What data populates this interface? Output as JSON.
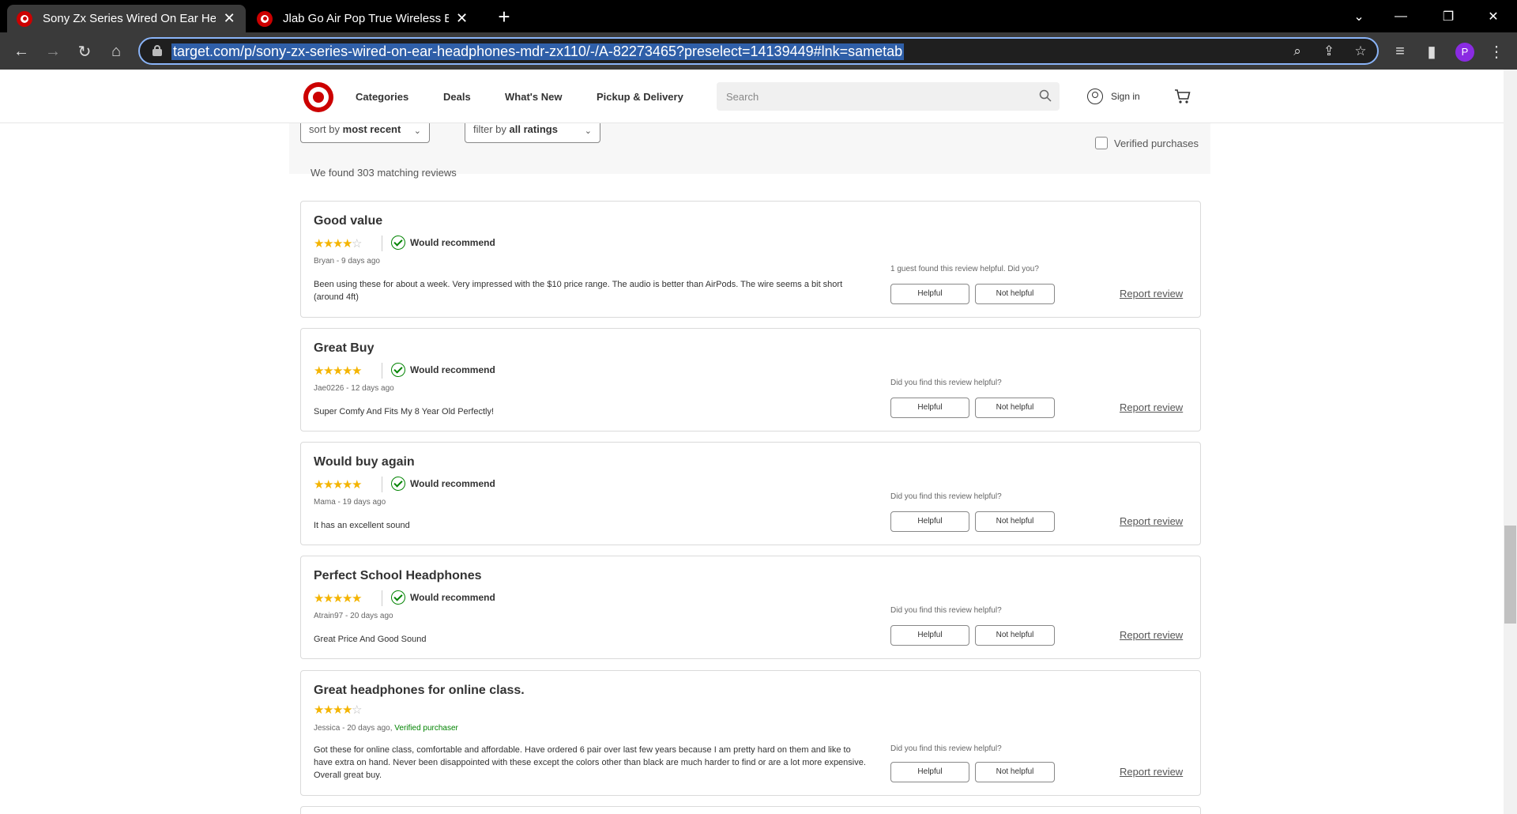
{
  "browser": {
    "tabs": [
      {
        "title": "Sony Zx Series Wired On Ear Hea",
        "active": true
      },
      {
        "title": "Jlab Go Air Pop True Wireless Blu",
        "active": false
      }
    ],
    "url": "target.com/p/sony-zx-series-wired-on-ear-headphones-mdr-zx110/-/A-82273465?preselect=14139449#lnk=sametab",
    "profile_initial": "P"
  },
  "header": {
    "nav": [
      "Categories",
      "Deals",
      "What's New",
      "Pickup & Delivery"
    ],
    "search_placeholder": "Search",
    "signin": "Sign in"
  },
  "filters": {
    "sort_prefix": "sort by",
    "sort_value": "most recent",
    "filter_prefix": "filter by",
    "filter_value": "all ratings",
    "verified_label": "Verified purchases",
    "verified_checked": false
  },
  "found_text": "We found 303 matching reviews",
  "labels": {
    "would_recommend": "Would recommend",
    "helpful": "Helpful",
    "not_helpful": "Not helpful",
    "report": "Report review"
  },
  "reviews": [
    {
      "title": "Good value",
      "rating": 4,
      "recommend": true,
      "byline": "Bryan - 9 days ago",
      "verified": "",
      "body": "Been using these for about a week. Very impressed with the $10 price range. The audio is better than AirPods. The wire seems a bit short (around 4ft)",
      "helpful_q": "1 guest found this review helpful. Did you?"
    },
    {
      "title": "Great Buy",
      "rating": 5,
      "recommend": true,
      "byline": "Jae0226 - 12 days ago",
      "verified": "",
      "body": "Super Comfy And Fits My 8 Year Old Perfectly!",
      "helpful_q": "Did you find this review helpful?"
    },
    {
      "title": "Would buy again",
      "rating": 5,
      "recommend": true,
      "byline": "Mama - 19 days ago",
      "verified": "",
      "body": "It has an excellent sound",
      "helpful_q": "Did you find this review helpful?"
    },
    {
      "title": "Perfect School Headphones",
      "rating": 5,
      "recommend": true,
      "byline": "Atrain97 - 20 days ago",
      "verified": "",
      "body": "Great Price And Good Sound",
      "helpful_q": "Did you find this review helpful?"
    },
    {
      "title": "Great headphones for online class.",
      "rating": 4,
      "recommend": false,
      "byline": "Jessica - 20 days ago, ",
      "verified": "Verified purchaser",
      "body": "Got these for online class, comfortable and affordable. Have ordered 6 pair over last few years because I am pretty hard on them and like to have extra on hand. Never been disappointed with these except the colors other than black are much harder to find or are a lot more expensive. Overall great buy.",
      "helpful_q": "Did you find this review helpful?"
    }
  ]
}
